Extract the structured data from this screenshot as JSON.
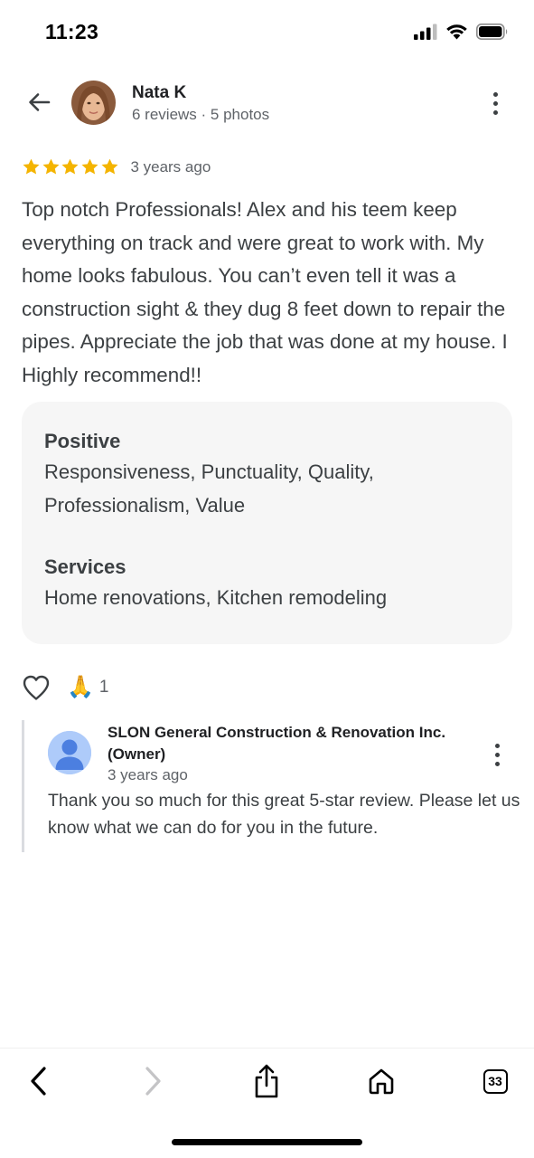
{
  "status_bar": {
    "time": "11:23"
  },
  "header": {
    "reviewer_name": "Nata K",
    "reviewer_meta": "6 reviews · 5 photos",
    "back_icon": "arrow-back-icon",
    "more_icon": "more-vert-icon"
  },
  "review": {
    "stars": 5,
    "star_color": "#f4b400",
    "time_ago": "3 years ago",
    "text": "Top notch Professionals! Alex and his teem keep everything on track and were great to work with. My home looks fabulous. You can’t even tell it was a construction sight & they dug 8 feet down to repair the pipes. Appreciate the job that was done at my house. I Highly recommend!!"
  },
  "attributes": {
    "positive_title": "Positive",
    "positive_value": "Responsiveness, Punctuality, Quality, Professionalism, Value",
    "services_title": "Services",
    "services_value": "Home renovations, Kitchen remodeling"
  },
  "reactions": {
    "like_icon": "heart-outline-icon",
    "reaction_emoji": "🙏",
    "reaction_count": "1"
  },
  "owner_reply": {
    "name": "SLON General Construction & Renovation Inc. (Owner)",
    "time_ago": "3 years ago",
    "text": "Thank you so much for this great 5-star review. Please let us know what we can do for you in the future."
  },
  "browser_toolbar": {
    "tabs_count": "33",
    "icons": [
      "back-icon",
      "forward-icon",
      "share-icon",
      "home-icon",
      "tabs-icon"
    ]
  }
}
